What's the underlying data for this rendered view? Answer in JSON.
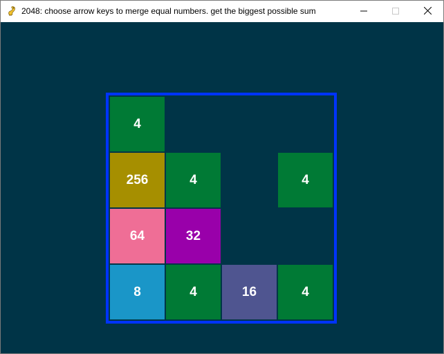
{
  "window": {
    "title": "2048: choose arrow keys to merge equal numbers. get the biggest possible sum"
  },
  "icons": {
    "app": "pygame-snake-icon",
    "minimize": "minimize-icon",
    "maximize": "maximize-icon",
    "close": "close-icon"
  },
  "colors": {
    "background": "#003447",
    "board_border": "#0033ff",
    "tile_4": "#007a35",
    "tile_8": "#1a96c8",
    "tile_16": "#4f5590",
    "tile_32": "#9900aa",
    "tile_64": "#ef6e96",
    "tile_256": "#a68f00"
  },
  "board": {
    "rows": [
      [
        {
          "value": "4",
          "color": "#007a35"
        },
        null,
        null,
        null
      ],
      [
        {
          "value": "256",
          "color": "#a68f00"
        },
        {
          "value": "4",
          "color": "#007a35"
        },
        null,
        {
          "value": "4",
          "color": "#007a35"
        }
      ],
      [
        {
          "value": "64",
          "color": "#ef6e96"
        },
        {
          "value": "32",
          "color": "#9900aa"
        },
        null,
        null
      ],
      [
        {
          "value": "8",
          "color": "#1a96c8"
        },
        {
          "value": "4",
          "color": "#007a35"
        },
        {
          "value": "16",
          "color": "#4f5590"
        },
        {
          "value": "4",
          "color": "#007a35"
        }
      ]
    ]
  }
}
